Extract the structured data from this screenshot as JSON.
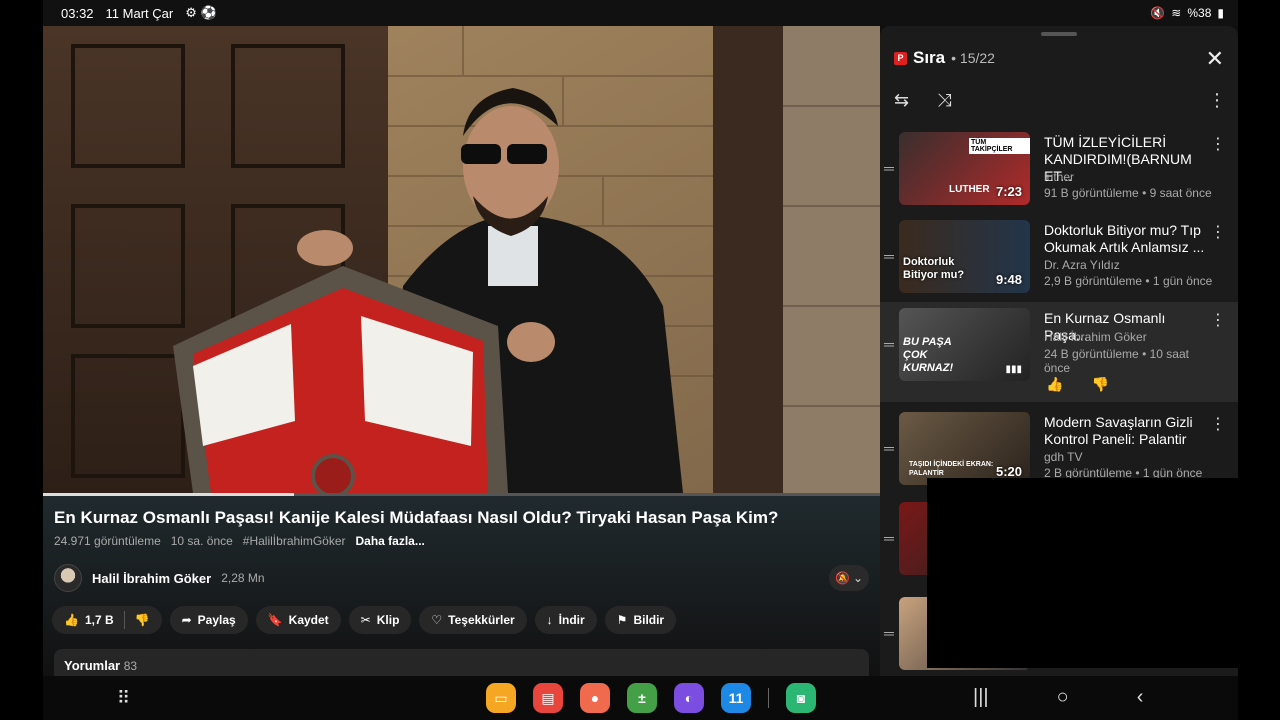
{
  "status": {
    "time": "03:32",
    "date": "11 Mart Çar",
    "left_icons": "⚙ ⚽",
    "battery": "%38"
  },
  "video": {
    "title": "En Kurnaz Osmanlı Paşası! Kanije Kalesi Müdafaası Nasıl Oldu? Tiryaki Hasan Paşa Kim?",
    "views": "24.971 görüntüleme",
    "age": "10 sa. önce",
    "hashtag": "#HalilİbrahimGöker",
    "more": "Daha fazla...",
    "progress": 0.3
  },
  "channel": {
    "name": "Halil İbrahim Göker",
    "subscribers": "2,28 Mn"
  },
  "actions": {
    "likes": "1,7 B",
    "share": "Paylaş",
    "save": "Kaydet",
    "clip": "Klip",
    "thanks": "Teşekkürler",
    "download": "İndir",
    "report": "Bildir"
  },
  "comments": {
    "label": "Yorumlar",
    "count": "83"
  },
  "queue": {
    "title": "Sıra",
    "position": "• 15/22",
    "items": [
      {
        "title": "TÜM İZLEYİCİLERİ KANDIRDIM!(BARNUM ET...",
        "channel": "luther",
        "meta": "91 B görüntüleme • 9 saat önce",
        "duration": "7:23",
        "thumb_text": "LUTHER"
      },
      {
        "title": "Doktorluk Bitiyor mu? Tıp Okumak Artık Anlamsız ...",
        "channel": "Dr. Azra Yıldız",
        "meta": "2,9 B görüntüleme • 1 gün önce",
        "duration": "9:48",
        "thumb_text": "Doktorluk Bitiyor mu?"
      },
      {
        "title": "En Kurnaz Osmanlı Paşa...",
        "channel": "Halil İbrahim Göker",
        "meta": "24 B görüntüleme • 10 saat önce",
        "duration": "",
        "thumb_text": "BU PAŞA ÇOK KURNAZ!"
      },
      {
        "title": "Modern Savaşların Gizli Kontrol Paneli: Palantir",
        "channel": "gdh TV",
        "meta": "2 B görüntüleme • 1 gün önce",
        "duration": "5:20",
        "thumb_text": "TAŞIDI İÇİNDEKİ EKRAN: PALANTİR"
      }
    ]
  },
  "colors": {
    "accent_red": "#e02020",
    "panel_bg": "#1b1b1b"
  }
}
